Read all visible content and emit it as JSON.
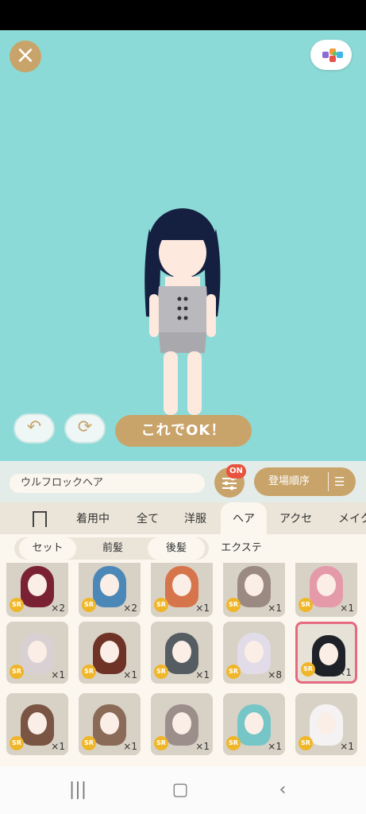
{
  "header": {
    "close_icon": "close-icon",
    "view_icon": "layout-icon"
  },
  "buttons": {
    "undo_icon": "undo-icon",
    "rotate_icon": "rotate-icon",
    "ok_label": "これでOK！"
  },
  "search": {
    "value": "ウルフロックヘア",
    "filter_icon": "filter-icon",
    "filter_badge": "ON",
    "sort_label": "登場順序",
    "sort_icon": "sort-icon"
  },
  "tabs": [
    {
      "label": "着用中"
    },
    {
      "label": "全て"
    },
    {
      "label": "洋服"
    },
    {
      "label": "ヘア"
    },
    {
      "label": "アクセ"
    },
    {
      "label": "メイク"
    }
  ],
  "subtabs": [
    {
      "label": "セット"
    },
    {
      "label": "前髪"
    },
    {
      "label": "後髪"
    },
    {
      "label": "エクステ"
    }
  ],
  "items": [
    {
      "rarity": "SR",
      "qty": "×2",
      "hair": "#7a2233"
    },
    {
      "rarity": "SR",
      "qty": "×2",
      "hair": "#4c88b7"
    },
    {
      "rarity": "SR",
      "qty": "×1",
      "hair": "#d6744b"
    },
    {
      "rarity": "SR",
      "qty": "×1",
      "hair": "#9a8a82"
    },
    {
      "rarity": "SR",
      "qty": "×1",
      "hair": "#e59aaa"
    },
    {
      "rarity": "SR",
      "qty": "×1",
      "hair": "#d9d0d3"
    },
    {
      "rarity": "SR",
      "qty": "×1",
      "hair": "#6e3326"
    },
    {
      "rarity": "SR",
      "qty": "×1",
      "hair": "#555d63"
    },
    {
      "rarity": "SR",
      "qty": "×8",
      "hair": "#e2dce9"
    },
    {
      "rarity": "SR",
      "qty": "×1",
      "hair": "#1f2128"
    },
    {
      "rarity": "SR",
      "qty": "×1",
      "hair": "#7a5543"
    },
    {
      "rarity": "SR",
      "qty": "×1",
      "hair": "#8a6b58"
    },
    {
      "rarity": "SR",
      "qty": "×1",
      "hair": "#9c8e8b"
    },
    {
      "rarity": "SR",
      "qty": "×1",
      "hair": "#76c6c7"
    },
    {
      "rarity": "SR",
      "qty": "×1",
      "hair": "#f4f2f2"
    }
  ],
  "colors": {
    "accent": "#c9a46a",
    "background": "#8cdad7",
    "badge": "#e8523f",
    "selected": "#e66a7f"
  },
  "nav": {
    "recents_icon": "recents-icon",
    "home_icon": "home-icon",
    "back_icon": "back-icon"
  }
}
